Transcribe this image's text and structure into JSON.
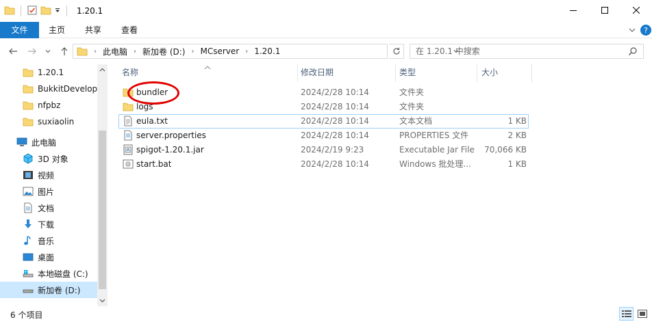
{
  "window": {
    "title": "1.20.1"
  },
  "ribbon": {
    "tabs": [
      "文件",
      "主页",
      "共享",
      "查看"
    ]
  },
  "address": {
    "crumbs": [
      "此电脑",
      "新加卷 (D:)",
      "MCserver",
      "1.20.1"
    ]
  },
  "search": {
    "placeholder": "在 1.20.1 中搜索"
  },
  "sidebar": {
    "items": [
      {
        "label": "1.20.1",
        "icon": "folder-icon"
      },
      {
        "label": "BukkitDevelopers",
        "icon": "folder-icon"
      },
      {
        "label": "nfpbz",
        "icon": "folder-icon"
      },
      {
        "label": "suxiaolin",
        "icon": "folder-icon"
      },
      {
        "label": "此电脑",
        "icon": "computer-icon"
      },
      {
        "label": "3D 对象",
        "icon": "3d-objects-icon"
      },
      {
        "label": "视频",
        "icon": "video-icon"
      },
      {
        "label": "图片",
        "icon": "pictures-icon"
      },
      {
        "label": "文档",
        "icon": "documents-icon"
      },
      {
        "label": "下载",
        "icon": "download-icon"
      },
      {
        "label": "音乐",
        "icon": "music-icon"
      },
      {
        "label": "桌面",
        "icon": "desktop-icon"
      },
      {
        "label": "本地磁盘 (C:)",
        "icon": "system-drive-icon"
      },
      {
        "label": "新加卷 (D:)",
        "icon": "drive-icon"
      }
    ]
  },
  "columns": {
    "name": "名称",
    "date": "修改日期",
    "type": "类型",
    "size": "大小"
  },
  "files": [
    {
      "name": "bundler",
      "date": "2024/2/28 10:14",
      "type": "文件夹",
      "size": "",
      "icon": "folder-icon"
    },
    {
      "name": "logs",
      "date": "2024/2/28 10:14",
      "type": "文件夹",
      "size": "",
      "icon": "folder-icon"
    },
    {
      "name": "eula.txt",
      "date": "2024/2/28 10:14",
      "type": "文本文档",
      "size": "1 KB",
      "icon": "text-file-icon"
    },
    {
      "name": "server.properties",
      "date": "2024/2/28 10:14",
      "type": "PROPERTIES 文件",
      "size": "2 KB",
      "icon": "properties-file-icon"
    },
    {
      "name": "spigot-1.20.1.jar",
      "date": "2024/2/19 9:23",
      "type": "Executable Jar File",
      "size": "70,066 KB",
      "icon": "jar-file-icon"
    },
    {
      "name": "start.bat",
      "date": "2024/2/28 10:14",
      "type": "Windows 批处理...",
      "size": "1 KB",
      "icon": "batch-file-icon"
    }
  ],
  "status": {
    "count": "6 个项目"
  },
  "colors": {
    "accent": "#1979ca",
    "folder": "#f8d775",
    "selection": "#cce8ff",
    "annotation": "#e00000"
  }
}
